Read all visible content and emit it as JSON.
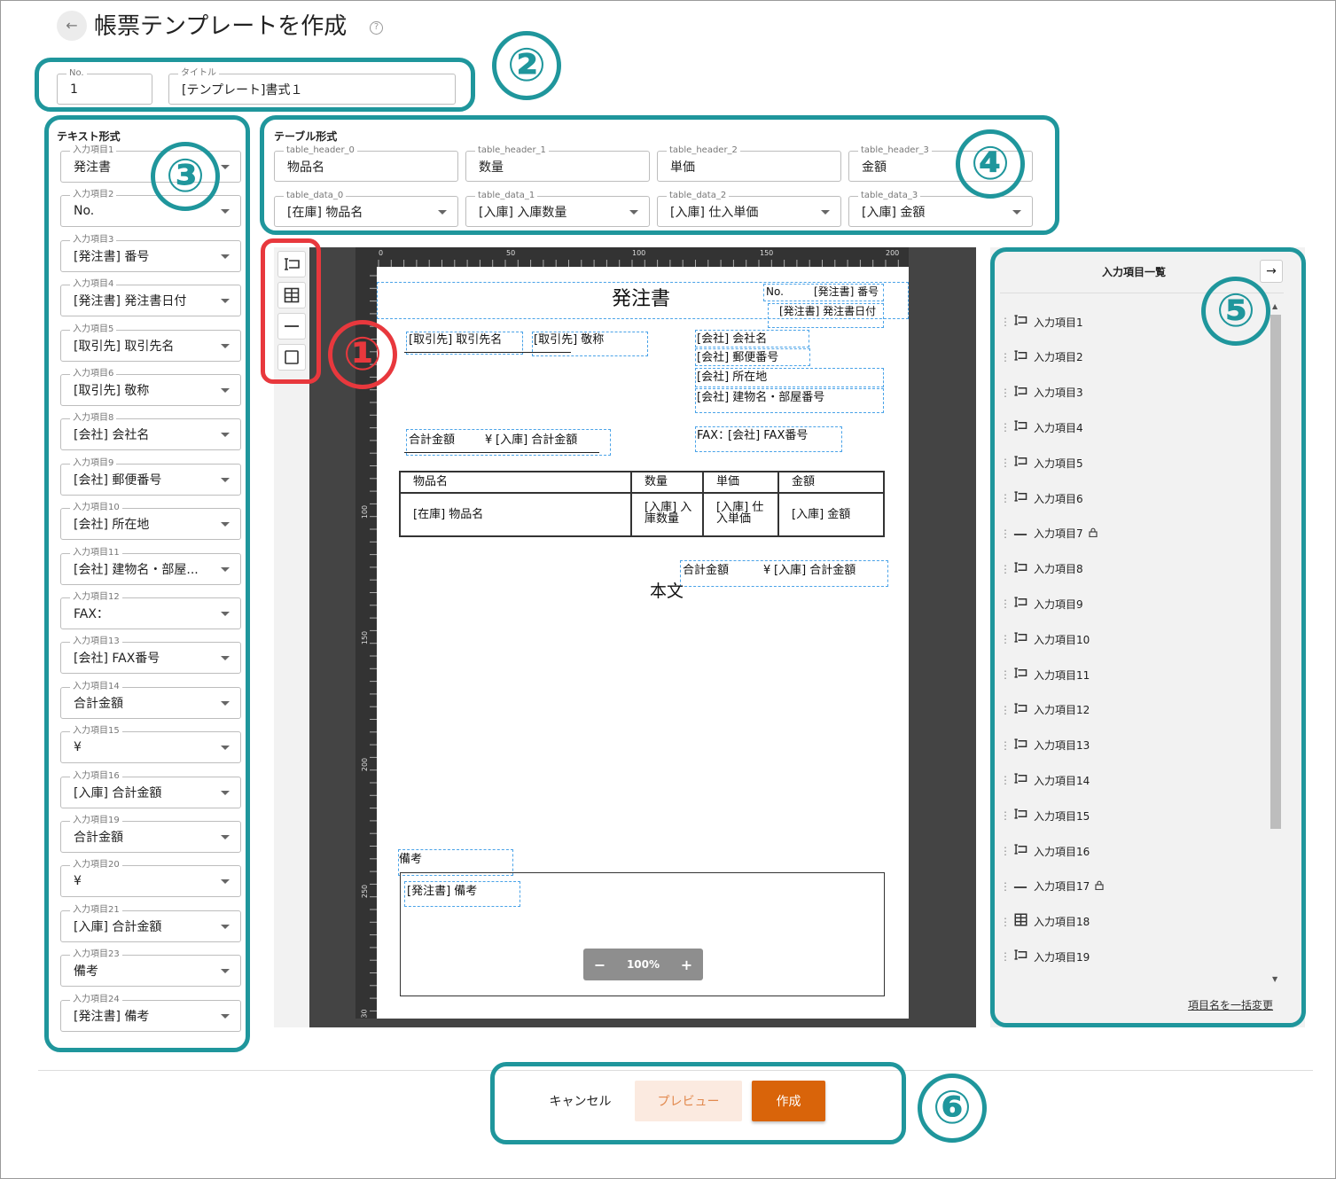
{
  "header": {
    "title": "帳票テンプレートを作成",
    "back_icon": "←",
    "help_icon": "?"
  },
  "meta_form": {
    "no_label": "No.",
    "no_value": "1",
    "title_label": "タイトル",
    "title_value": "[テンプレート]書式１"
  },
  "text_section": {
    "heading": "テキスト形式",
    "fields": [
      {
        "label": "入力項目1",
        "value": "発注書"
      },
      {
        "label": "入力項目2",
        "value": "No."
      },
      {
        "label": "入力項目3",
        "value": "[発注書] 番号"
      },
      {
        "label": "入力項目4",
        "value": "[発注書] 発注書日付"
      },
      {
        "label": "入力項目5",
        "value": "[取引先] 取引先名"
      },
      {
        "label": "入力項目6",
        "value": "[取引先] 敬称"
      },
      {
        "label": "入力項目8",
        "value": "[会社] 会社名"
      },
      {
        "label": "入力項目9",
        "value": "[会社] 郵便番号"
      },
      {
        "label": "入力項目10",
        "value": "[会社] 所在地"
      },
      {
        "label": "入力項目11",
        "value": "[会社] 建物名・部屋..."
      },
      {
        "label": "入力項目12",
        "value": "FAX："
      },
      {
        "label": "入力項目13",
        "value": "[会社] FAX番号"
      },
      {
        "label": "入力項目14",
        "value": "合計金額"
      },
      {
        "label": "入力項目15",
        "value": "¥"
      },
      {
        "label": "入力項目16",
        "value": "[入庫] 合計金額"
      },
      {
        "label": "入力項目19",
        "value": "合計金額"
      },
      {
        "label": "入力項目20",
        "value": "¥"
      },
      {
        "label": "入力項目21",
        "value": "[入庫] 合計金額"
      },
      {
        "label": "入力項目23",
        "value": "備考"
      },
      {
        "label": "入力項目24",
        "value": "[発注書] 備考"
      }
    ]
  },
  "table_section": {
    "heading": "テーブル形式",
    "headers": [
      {
        "label": "table_header_0",
        "value": "物品名"
      },
      {
        "label": "table_header_1",
        "value": "数量"
      },
      {
        "label": "table_header_2",
        "value": "単価"
      },
      {
        "label": "table_header_3",
        "value": "金額"
      }
    ],
    "data": [
      {
        "label": "table_data_0",
        "value": "[在庫] 物品名"
      },
      {
        "label": "table_data_1",
        "value": "[入庫] 入庫数量"
      },
      {
        "label": "table_data_2",
        "value": "[入庫] 仕入単価"
      },
      {
        "label": "table_data_3",
        "value": "[入庫] 金額"
      }
    ]
  },
  "toolbar": {
    "icons": [
      "text-field-icon",
      "table-icon",
      "line-icon",
      "rectangle-icon"
    ]
  },
  "canvas": {
    "ruler_top": [
      "0",
      "50",
      "100",
      "150",
      "200"
    ],
    "ruler_left": [
      "100",
      "150",
      "200",
      "250",
      "30"
    ],
    "doc_title": "発注書",
    "no_label": "No.",
    "no_value": "[発注書] 番号",
    "date_value": "[発注書] 発注書日付",
    "client_name": "[取引先] 取引先名",
    "client_honor": "[取引先] 敬称",
    "company_name": "[会社] 会社名",
    "company_zip": "[会社] 郵便番号",
    "company_addr": "[会社] 所在地",
    "company_bldg": "[会社] 建物名・部屋番号",
    "total_label": "合計金額",
    "yen": "¥",
    "total_value": "[入庫] 合計金額",
    "fax_label": "FAX：",
    "fax_value": "[会社] FAX番号",
    "table_h": [
      "物品名",
      "数量",
      "単価",
      "金額"
    ],
    "table_d0": "[在庫] 物品名",
    "table_d1a": "[入庫] 入",
    "table_d1b": "庫数量",
    "table_d2a": "[入庫] 仕",
    "table_d2b": "入単価",
    "table_d3": "[入庫] 金額",
    "total2_label": "合計金額",
    "yen2": "¥",
    "total2_value": "[入庫] 合計金額",
    "body_label": "本文",
    "remarks_label": "備考",
    "remarks_value": "[発注書] 備考",
    "zoom": "100%",
    "zoom_minus": "−",
    "zoom_plus": "+"
  },
  "input_list": {
    "title": "入力項目一覧",
    "collapse_icon": "→",
    "rename_link": "項目名を一括変更",
    "items": [
      {
        "icon": "text",
        "label": "入力項目1"
      },
      {
        "icon": "text",
        "label": "入力項目2"
      },
      {
        "icon": "text",
        "label": "入力項目3"
      },
      {
        "icon": "text",
        "label": "入力項目4"
      },
      {
        "icon": "text",
        "label": "入力項目5"
      },
      {
        "icon": "text",
        "label": "入力項目6"
      },
      {
        "icon": "line",
        "label": "入力項目7",
        "locked": true
      },
      {
        "icon": "text",
        "label": "入力項目8"
      },
      {
        "icon": "text",
        "label": "入力項目9"
      },
      {
        "icon": "text",
        "label": "入力項目10"
      },
      {
        "icon": "text",
        "label": "入力項目11"
      },
      {
        "icon": "text",
        "label": "入力項目12"
      },
      {
        "icon": "text",
        "label": "入力項目13"
      },
      {
        "icon": "text",
        "label": "入力項目14"
      },
      {
        "icon": "text",
        "label": "入力項目15"
      },
      {
        "icon": "text",
        "label": "入力項目16"
      },
      {
        "icon": "line",
        "label": "入力項目17",
        "locked": true
      },
      {
        "icon": "table",
        "label": "入力項目18"
      },
      {
        "icon": "text",
        "label": "入力項目19"
      }
    ]
  },
  "actions": {
    "cancel": "キャンセル",
    "preview": "プレビュー",
    "create": "作成"
  },
  "annotations": [
    "①",
    "②",
    "③",
    "④",
    "⑤",
    "⑥"
  ],
  "colors": {
    "teal": "#1f969c",
    "red": "#e8383d",
    "primary": "#d9640a",
    "preview_bg": "#fbeae0",
    "dashed": "#4aa3e8"
  }
}
